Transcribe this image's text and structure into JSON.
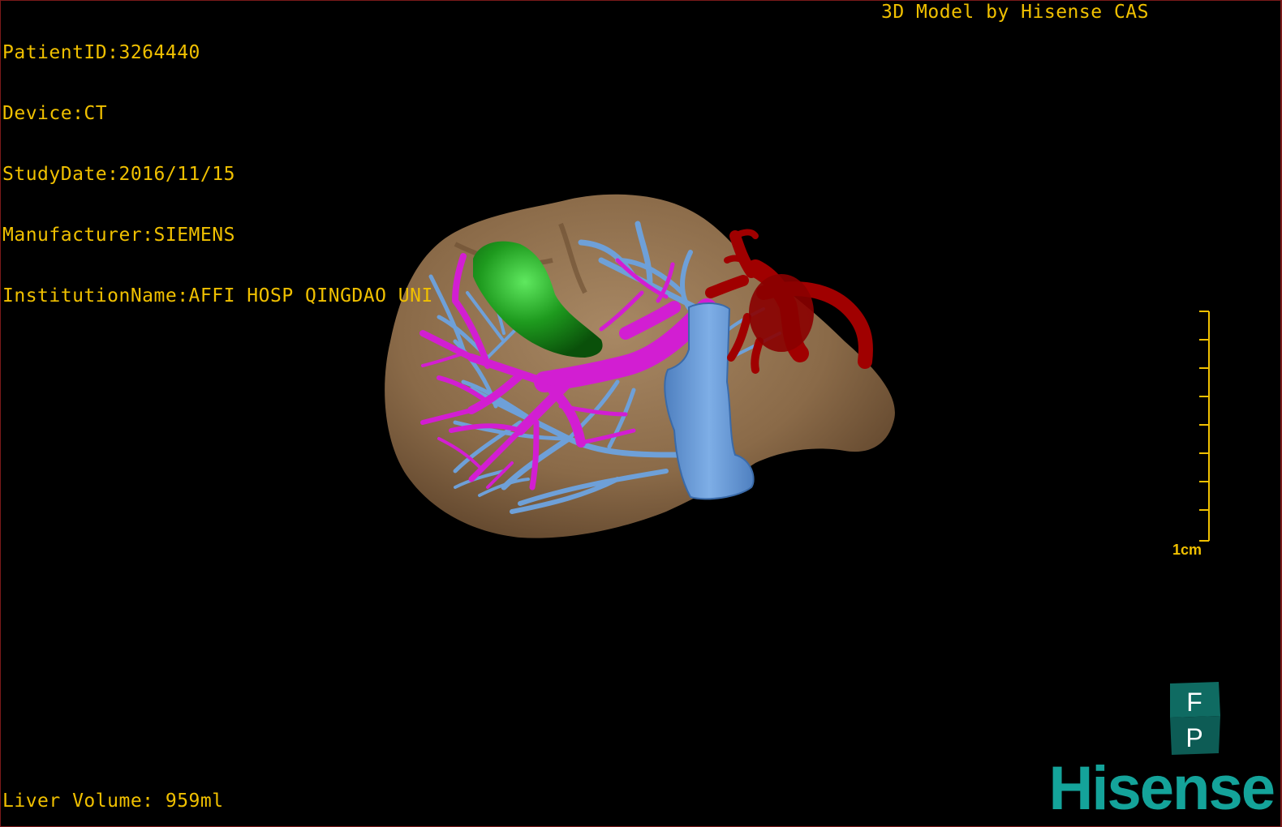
{
  "header": {
    "patient_id": "PatientID:3264440",
    "device": "Device:CT",
    "study_date": "StudyDate:2016/11/15",
    "manufacturer": "Manufacturer:SIEMENS",
    "institution": "InstitutionName:AFFI HOSP QINGDAO UNI",
    "watermark": "3D Model by Hisense CAS"
  },
  "scale": {
    "label": "1cm"
  },
  "footer": {
    "volume": "Liver Volume: 959ml"
  },
  "orientation_cube": {
    "top_face": "F",
    "bottom_face": "P"
  },
  "brand": {
    "name": "Hisense"
  },
  "colors": {
    "overlay_text": "#f0c000",
    "liver": "#8a6a48",
    "hepatic_vein": "#6ea0d8",
    "portal_vein": "#d21ed2",
    "gallbladder": "#1e9a1e",
    "artery": "#a00000",
    "brand": "#14a39a"
  }
}
